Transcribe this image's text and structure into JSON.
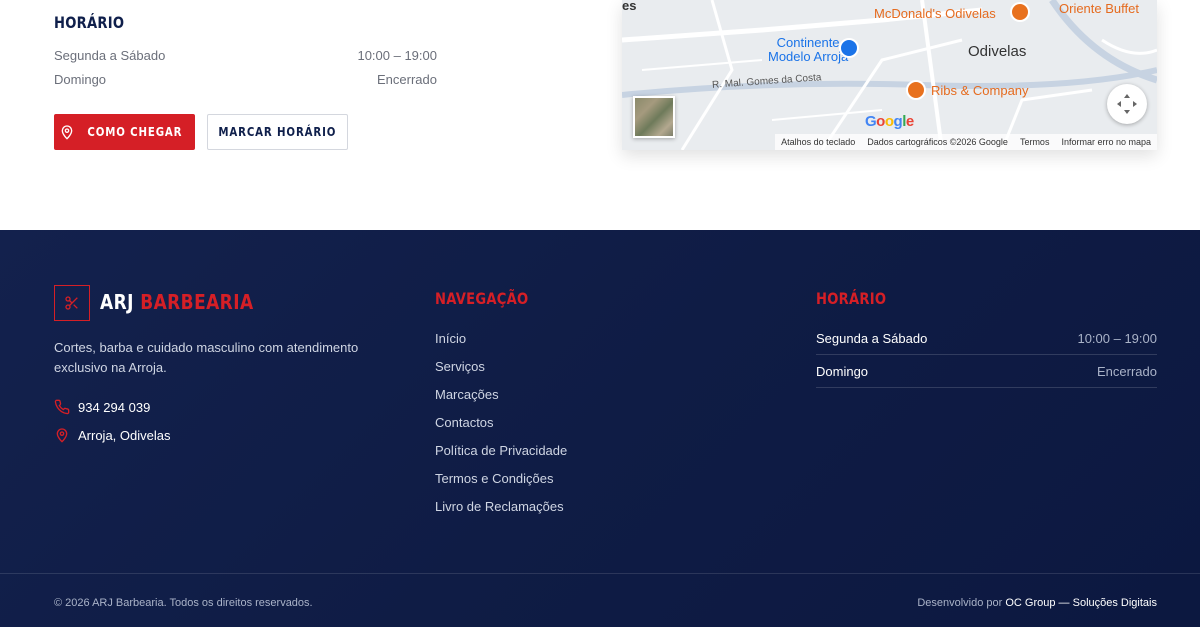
{
  "hours": {
    "title": "HORÁRIO",
    "rows": [
      {
        "day": "Segunda a Sábado",
        "time": "10:00 – 19:00"
      },
      {
        "day": "Domingo",
        "time": "Encerrado"
      }
    ]
  },
  "buttons": {
    "directions": "COMO CHEGAR",
    "book": "MARCAR HORÁRIO"
  },
  "map": {
    "labels": {
      "es": "es",
      "mcdonalds": "McDonald's Odivelas",
      "oriente": "Oriente Buffet",
      "continente_1": "Continente",
      "continente_2": "Modelo Arroja",
      "odivelas": "Odivelas",
      "road": "R. Mal. Gomes da Costa",
      "ribs": "Ribs & Company",
      "google": "Google"
    },
    "footer": {
      "shortcuts": "Atalhos do teclado",
      "data": "Dados cartográficos ©2026 Google",
      "terms": "Termos",
      "report": "Informar erro no mapa"
    }
  },
  "footer": {
    "brand_a": "ARJ",
    "brand_b": "BARBEARIA",
    "description": "Cortes, barba e cuidado masculino com atendimento exclusivo na Arroja.",
    "phone": "934 294 039",
    "location": "Arroja, Odivelas",
    "nav_title": "NAVEGAÇÃO",
    "nav": [
      "Início",
      "Serviços",
      "Marcações",
      "Contactos",
      "Política de Privacidade",
      "Termos e Condições",
      "Livro de Reclamações"
    ],
    "hours_title": "HORÁRIO",
    "hours": [
      {
        "day": "Segunda a Sábado",
        "time": "10:00 – 19:00"
      },
      {
        "day": "Domingo",
        "time": "Encerrado"
      }
    ],
    "copyright": "© 2026 ARJ Barbearia. Todos os direitos reservados.",
    "dev_prefix": "Desenvolvido por",
    "dev_link": "OC Group — Soluções Digitais"
  },
  "colors": {
    "accent": "#d51f26",
    "navy": "#0f1f4b"
  }
}
